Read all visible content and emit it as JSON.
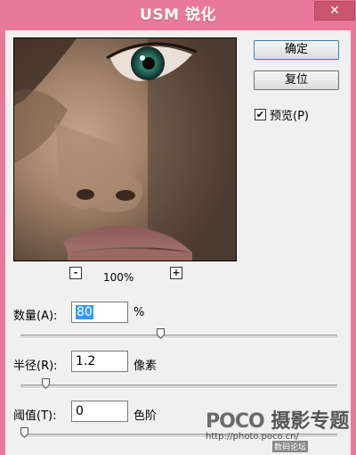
{
  "window": {
    "title": "USM 锐化",
    "close_glyph": "✕"
  },
  "buttons": {
    "ok": "确定",
    "reset": "复位"
  },
  "preview": {
    "checked": true,
    "label": "预览(P)"
  },
  "zoom": {
    "minus": "-",
    "plus": "+",
    "level": "100%"
  },
  "fields": {
    "amount": {
      "label": "数量(A):",
      "value": "80",
      "unit": "%",
      "slider_fraction": 0.44
    },
    "radius": {
      "label": "半径(R):",
      "value": "1.2",
      "unit": "像素",
      "slider_fraction": 0.07
    },
    "threshold": {
      "label": "阈值(T):",
      "value": "0",
      "unit": "色阶",
      "slider_fraction": 0.0
    }
  },
  "watermark": {
    "brand": "POCO",
    "text": "摄影专题",
    "url": "http://photo.poco.cn/",
    "overlay": "数码论坛"
  }
}
